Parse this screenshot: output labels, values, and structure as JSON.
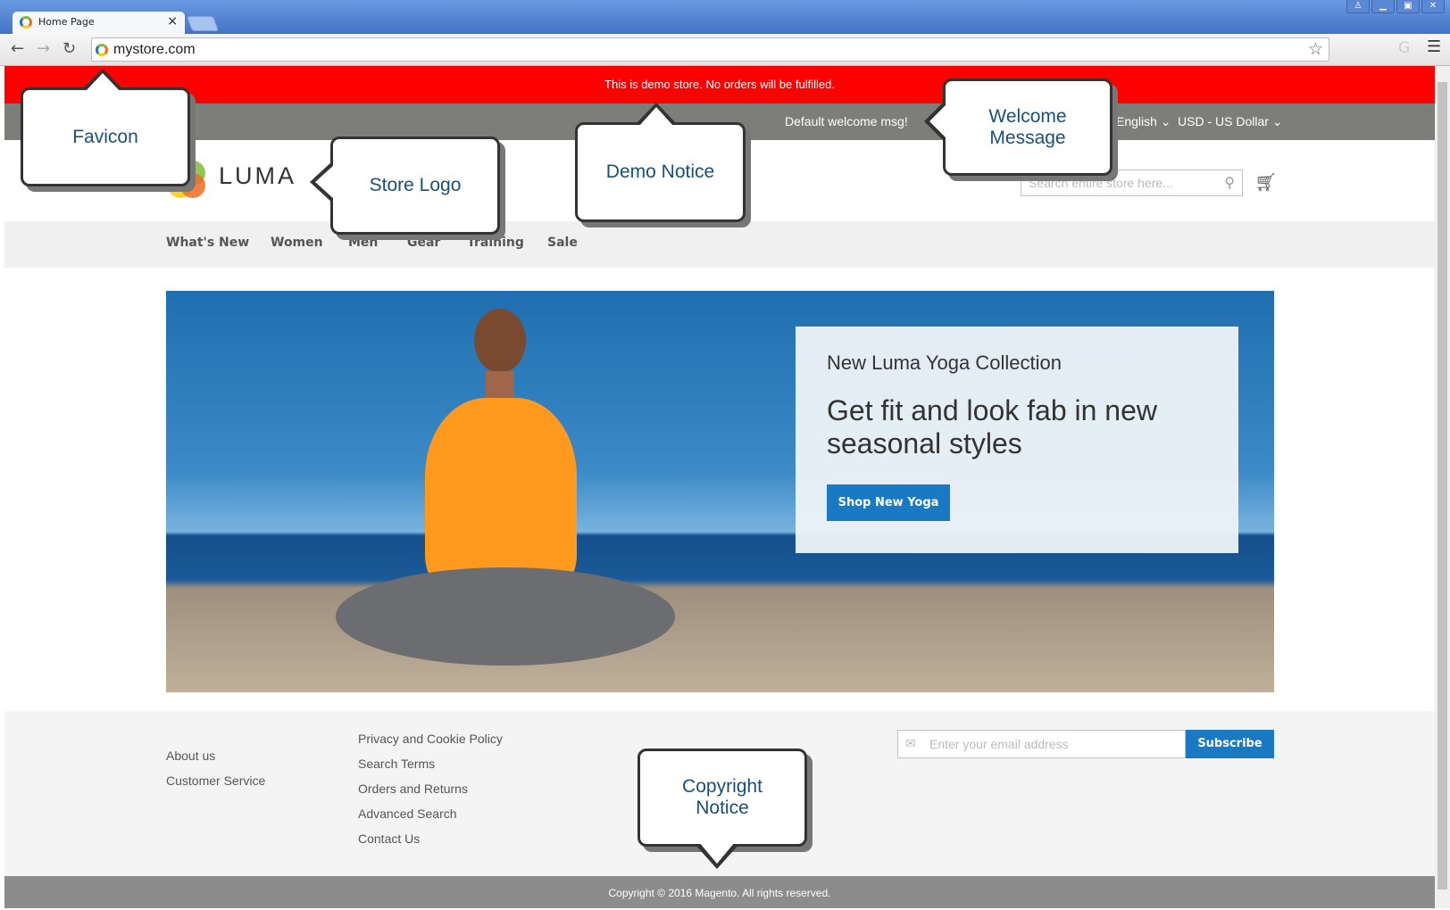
{
  "browser": {
    "tab_title": "Home Page",
    "tab_close": "×",
    "url": "mystore.com",
    "window_controls": [
      "user",
      "minimize",
      "maximize",
      "close"
    ]
  },
  "demo_notice": "This is demo store. No orders will be fulfilled.",
  "panel": {
    "welcome": "Default welcome msg!",
    "language": "English",
    "currency": "USD - US Dollar"
  },
  "header": {
    "logo_text": "LUMA",
    "search_placeholder": "Search entire store here..."
  },
  "nav": [
    "What's New",
    "Women",
    "Men",
    "Gear",
    "Training",
    "Sale"
  ],
  "hero": {
    "subtitle": "New Luma Yoga Collection",
    "title_line1": "Get fit and look fab in new",
    "title_line2": "seasonal styles",
    "button": "Shop New Yoga"
  },
  "footer": {
    "col1": [
      "About us",
      "Customer Service"
    ],
    "col2": [
      "Privacy and Cookie Policy",
      "Search Terms",
      "Orders and Returns",
      "Advanced Search",
      "Contact Us"
    ],
    "email_placeholder": "Enter your email address",
    "subscribe": "Subscribe",
    "copyright": "Copyright © 2016 Magento. All rights reserved."
  },
  "callouts": {
    "favicon": "Favicon",
    "logo": "Store Logo",
    "demo": "Demo Notice",
    "welcome_1": "Welcome",
    "welcome_2": "Message",
    "copyright_1": "Copyright",
    "copyright_2": "Notice"
  },
  "colors": {
    "demo_bar": "#ff0000",
    "panel": "#7d7d7a",
    "accent": "#1979c3"
  }
}
